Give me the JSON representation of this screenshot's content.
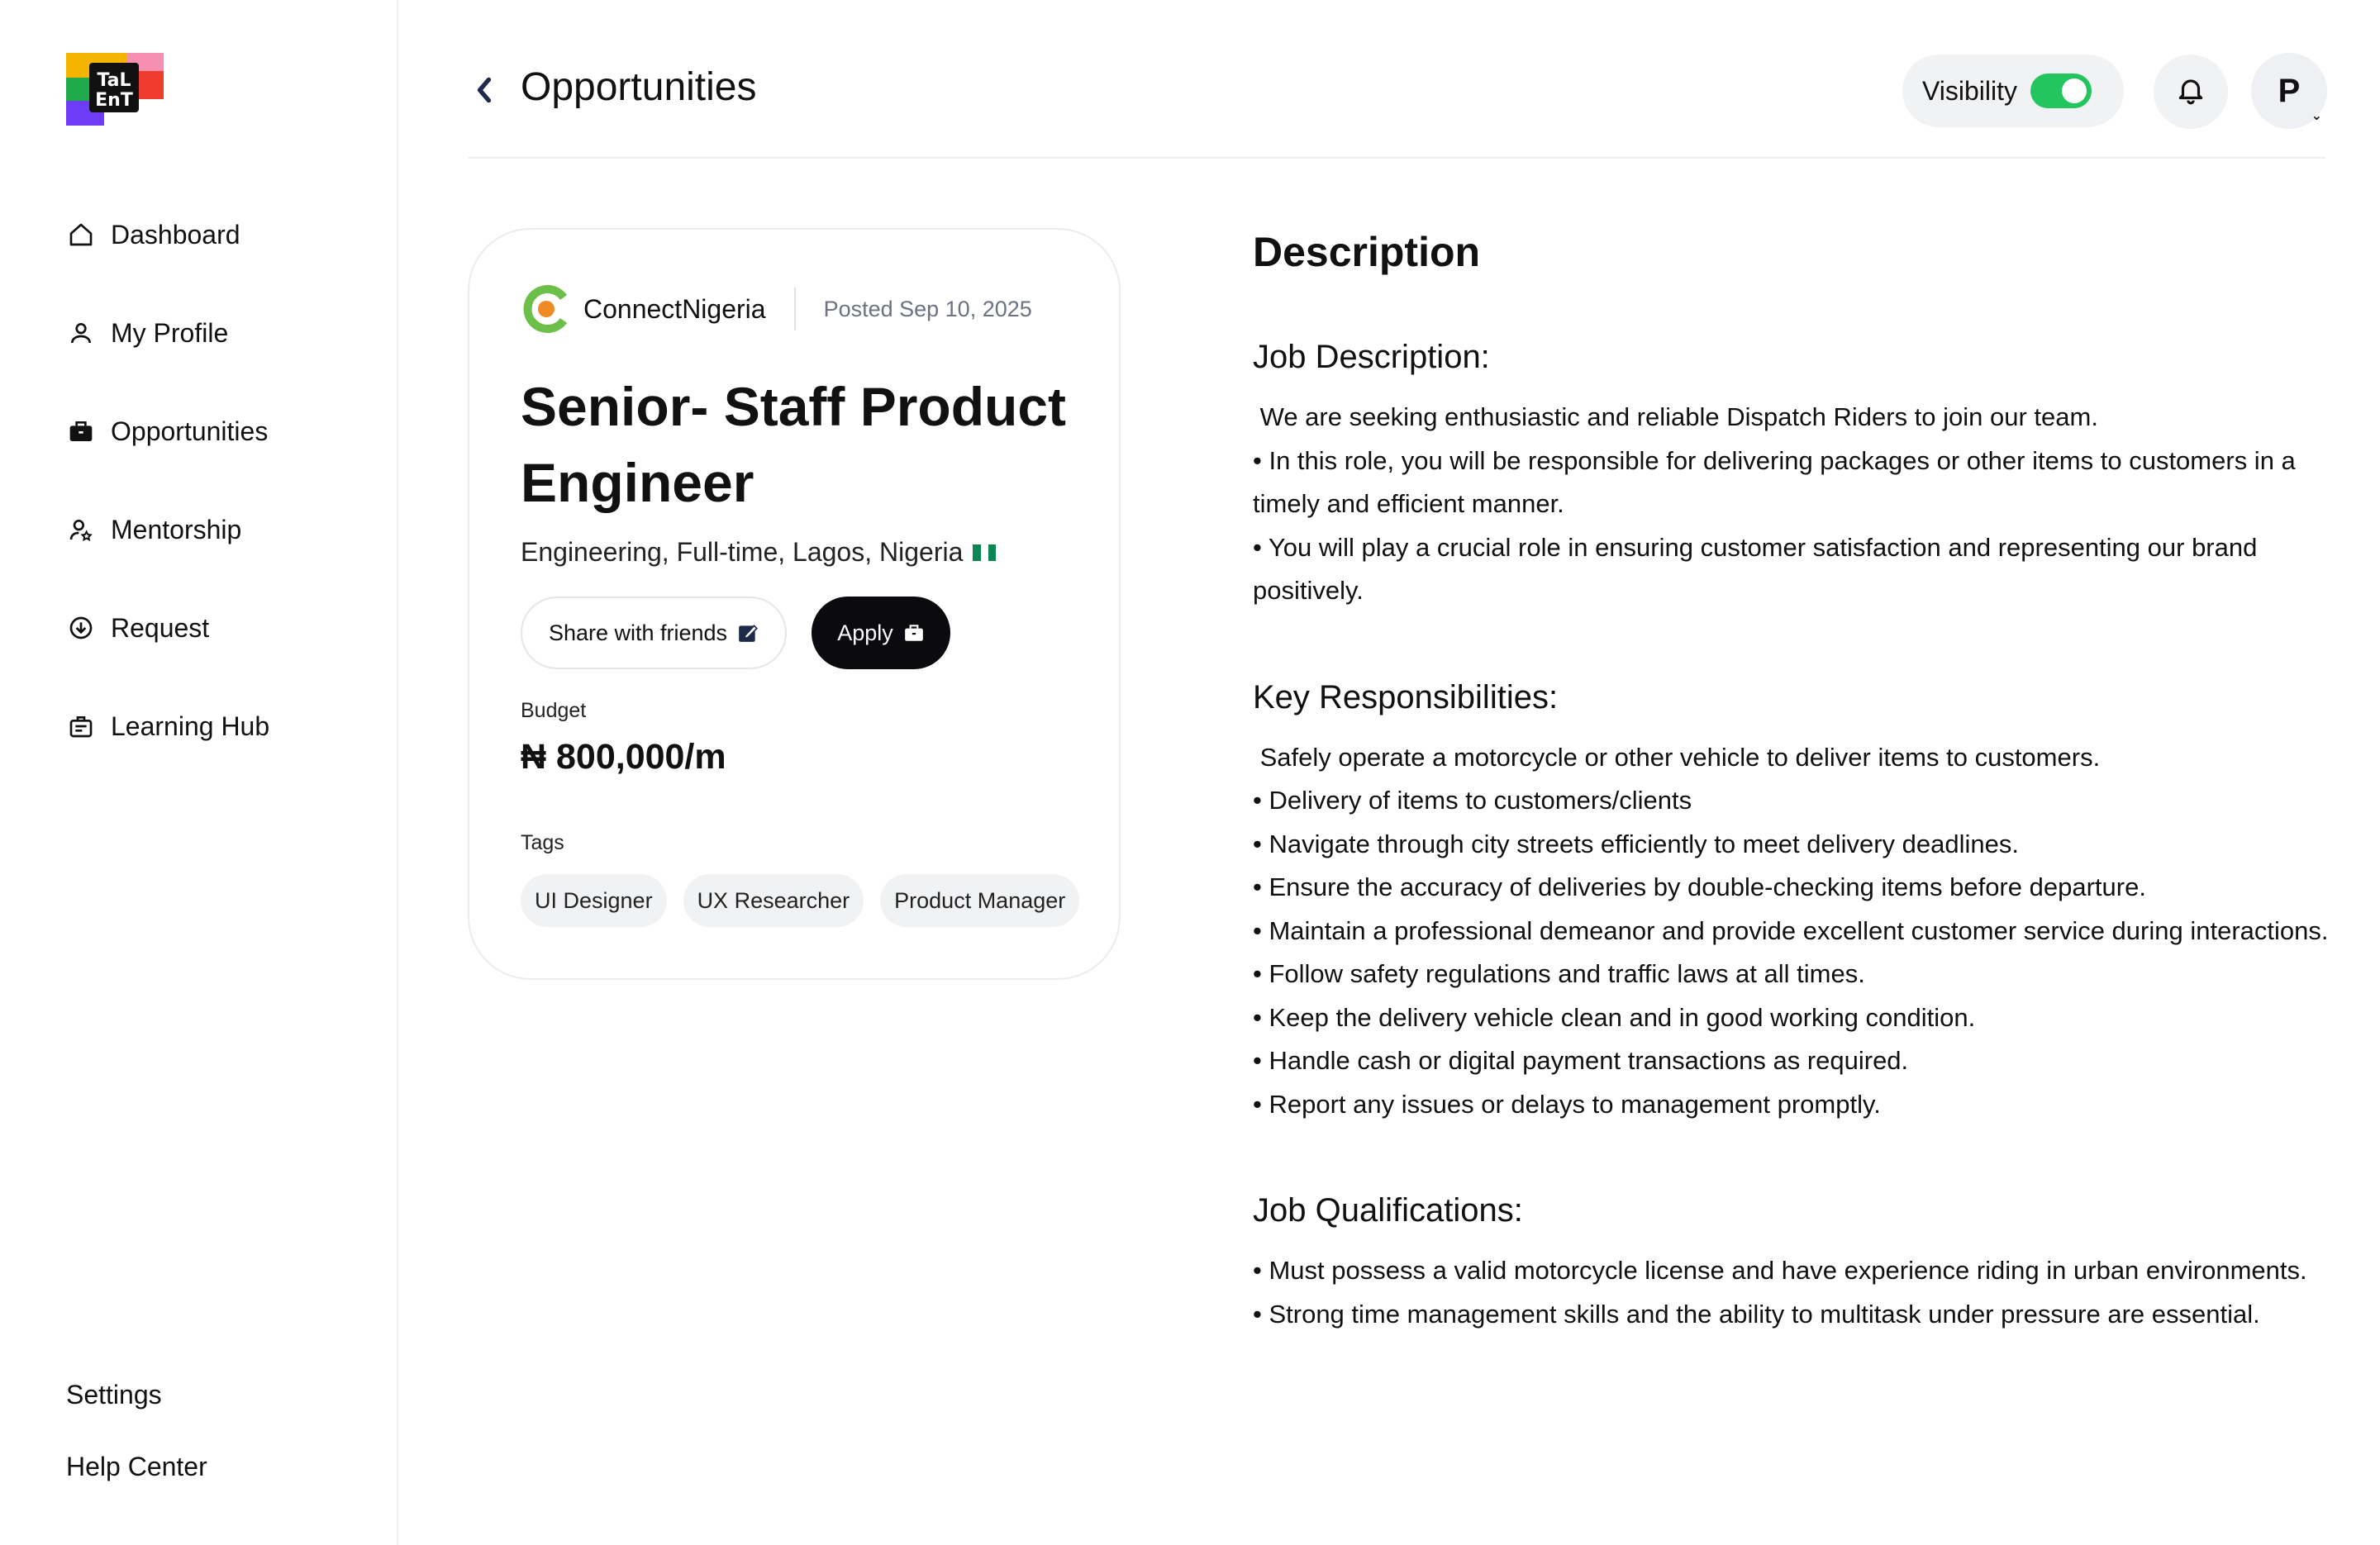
{
  "brand": {
    "logo_text": "TALENT"
  },
  "sidebar": {
    "items": [
      {
        "label": "Dashboard",
        "icon": "home-icon"
      },
      {
        "label": "My Profile",
        "icon": "user-icon"
      },
      {
        "label": "Opportunities",
        "icon": "briefcase-icon"
      },
      {
        "label": "Mentorship",
        "icon": "mentor-icon"
      },
      {
        "label": "Request",
        "icon": "download-circle-icon"
      },
      {
        "label": "Learning Hub",
        "icon": "learning-icon"
      }
    ],
    "settings_label": "Settings",
    "help_label": "Help Center"
  },
  "header": {
    "title": "Opportunities",
    "visibility_label": "Visibility",
    "visibility_on": true,
    "avatar_initial": "P",
    "accent_color": "#22c55e"
  },
  "job": {
    "company": "ConnectNigeria",
    "posted": "Posted Sep 10, 2025",
    "title": "Senior- Staff Product Engineer",
    "meta": "Engineering, Full-time, Lagos, Nigeria",
    "share_label": "Share with friends",
    "apply_label": "Apply",
    "budget_label": "Budget",
    "budget_value": "₦ 800,000/m",
    "tags_label": "Tags",
    "tags": [
      "UI Designer",
      "UX Researcher",
      "Product Manager"
    ]
  },
  "description": {
    "title": "Description",
    "sections": [
      {
        "heading": "Job Description:",
        "body": " We are seeking enthusiastic and reliable Dispatch Riders to join our team.\n• In this role, you will be responsible for delivering packages or other items to customers in a timely and efficient manner.\n• You will play a crucial role in ensuring customer satisfaction and representing our brand positively."
      },
      {
        "heading": "Key Responsibilities:",
        "body": " Safely operate a motorcycle or other vehicle to deliver items to customers.\n• Delivery of items to customers/clients\n• Navigate through city streets efficiently to meet delivery deadlines.\n• Ensure the accuracy of deliveries by double-checking items before departure.\n• Maintain a professional demeanor and provide excellent customer service during interactions.\n• Follow safety regulations and traffic laws at all times.\n• Keep the delivery vehicle clean and in good working condition.\n• Handle cash or digital payment transactions as required.\n• Report any issues or delays to management promptly."
      },
      {
        "heading": "Job Qualifications:",
        "body": "• Must possess a valid motorcycle license and have experience riding in urban environments.\n• Strong time management skills and the ability to multitask under pressure are essential."
      }
    ]
  }
}
